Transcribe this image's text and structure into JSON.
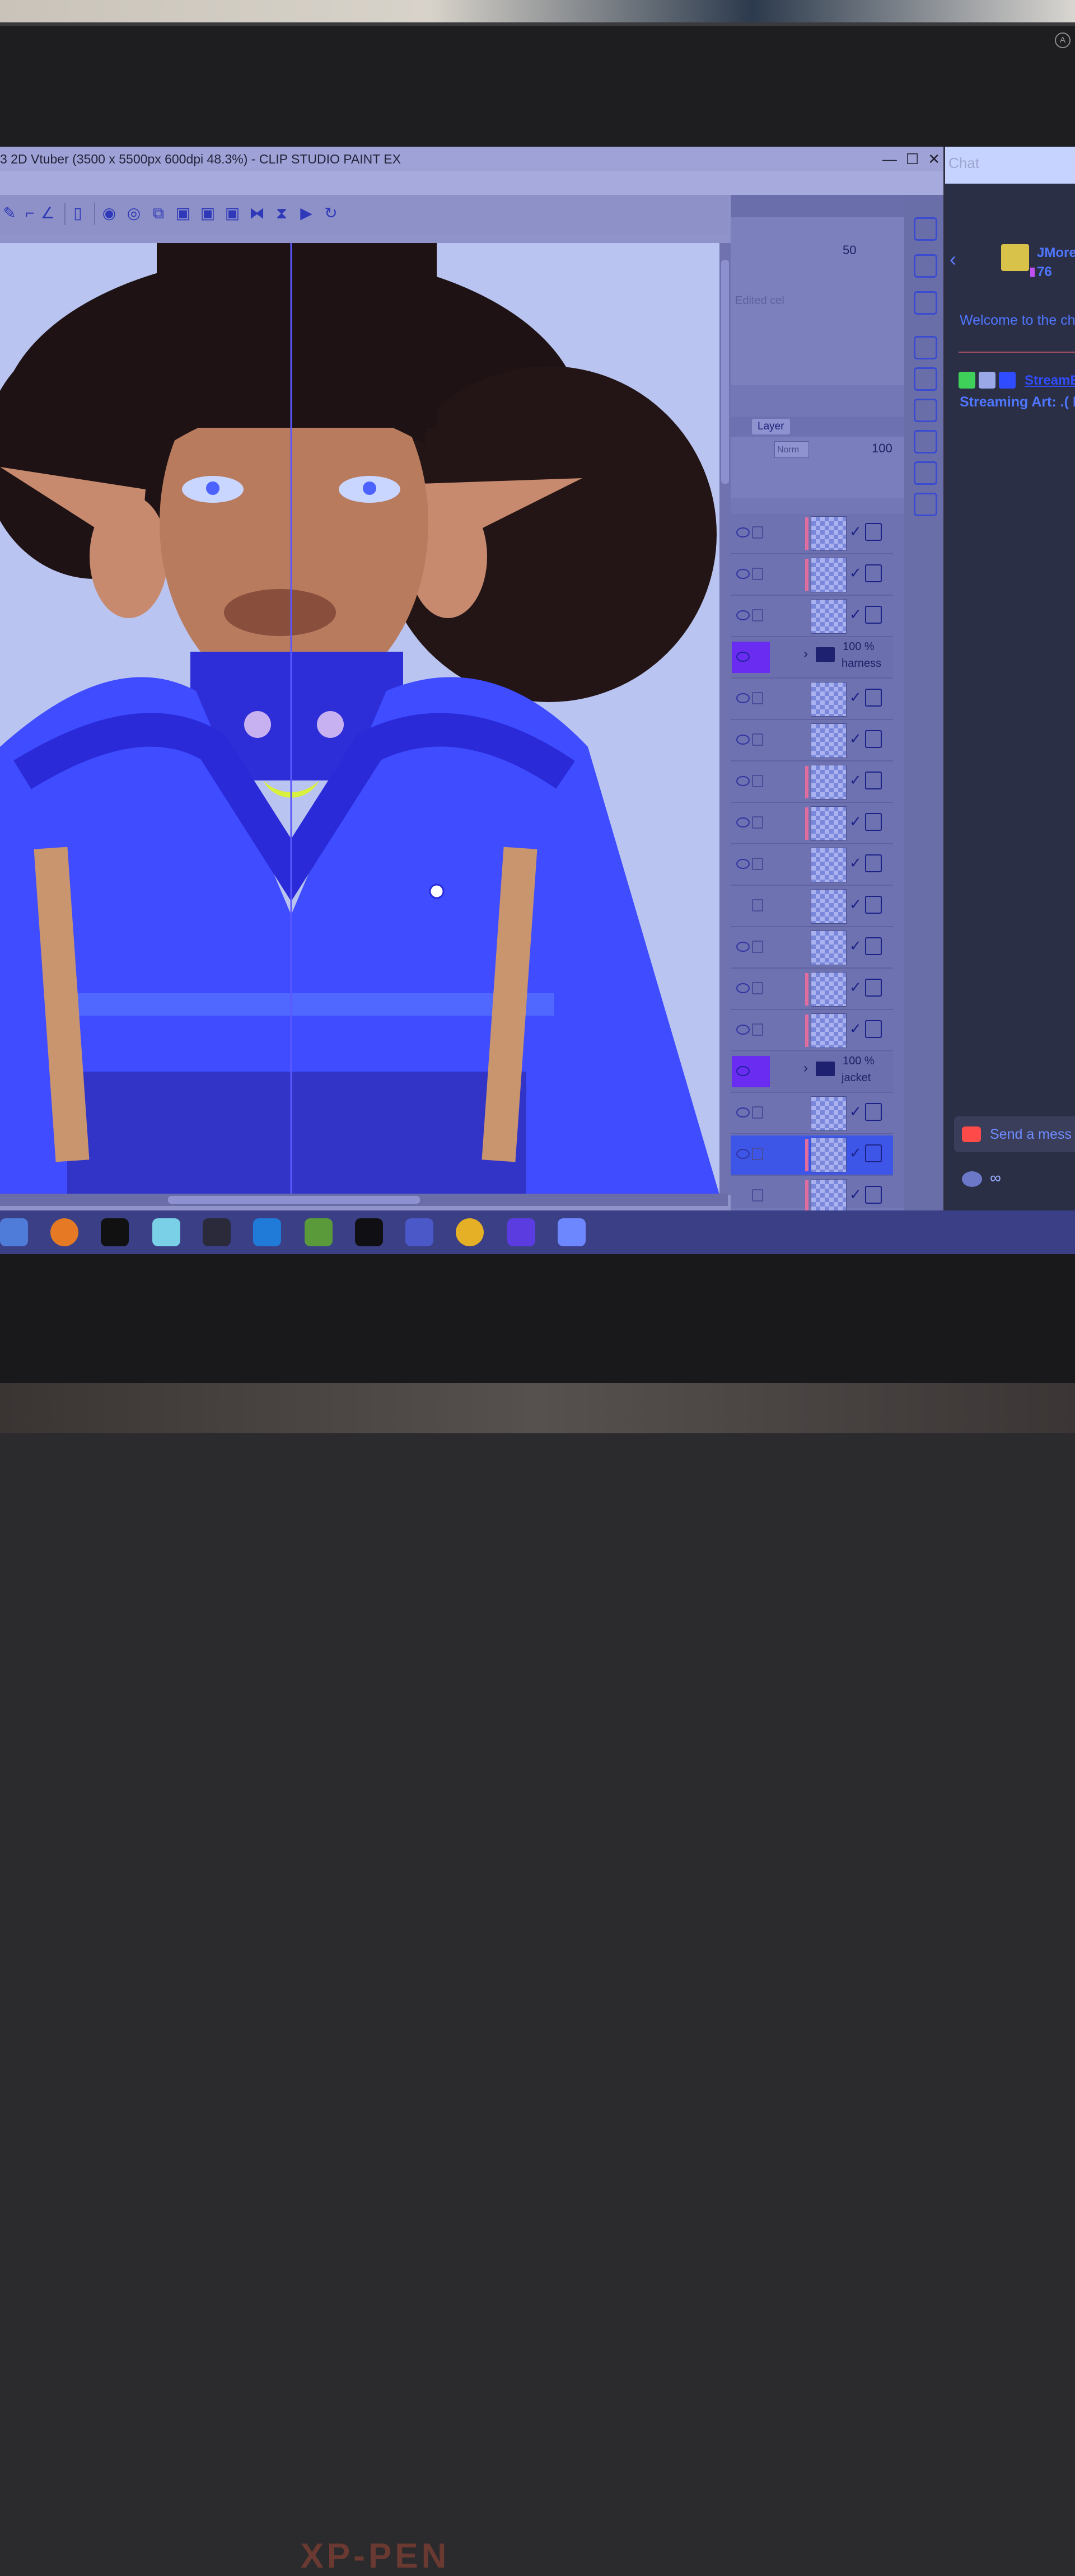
{
  "window": {
    "title": "3 2D Vtuber (3500 x 5500px 600dpi 48.3%)  - CLIP STUDIO PAINT EX",
    "minimize": "—",
    "maximize": "☐",
    "close": "✕"
  },
  "navigator": {
    "zoom_value": "50",
    "edited_cel_label": "Edited cel"
  },
  "layer_panel": {
    "tab_label": "Layer",
    "blend_mode": "Norm",
    "opacity": "100",
    "folders": [
      {
        "opacity": "100 %",
        "name": "harness"
      },
      {
        "opacity": "100 %",
        "name": "jacket"
      }
    ]
  },
  "chat": {
    "title": "Chat",
    "gift_user": "JMore",
    "gift_count": "76",
    "welcome": "Welcome to the ch",
    "stream_user": "StreamE",
    "stream_message": "Streaming Art: .( I'r",
    "send_placeholder": "Send a mess",
    "footer_value": "∞"
  },
  "bezel": {
    "brand": "XP-PEN",
    "power_icon": "A"
  },
  "colors": {
    "accent_blue": "#3f4cff",
    "selection_purple": "#6a2cf0",
    "chat_link": "#4f76ff"
  }
}
